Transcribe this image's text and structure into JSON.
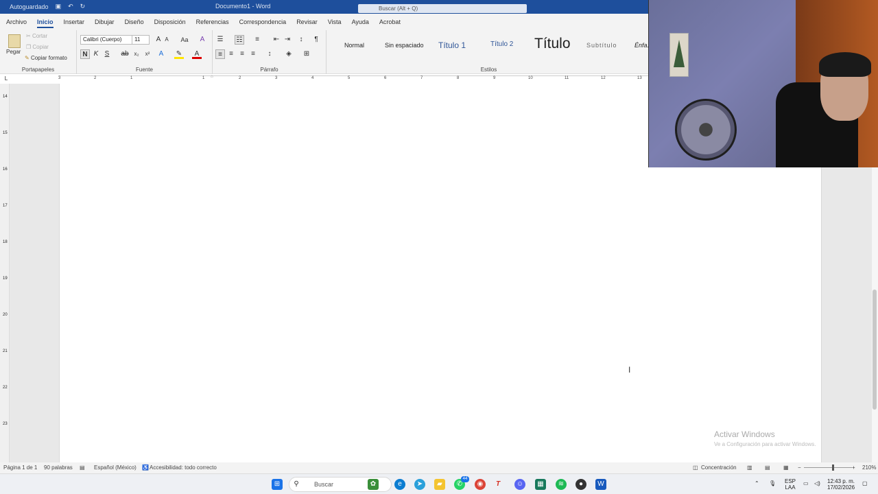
{
  "titlebar": {
    "autosave": "Autoguardado",
    "document": "Documento1 - Word",
    "search_placeholder": "Buscar (Alt + Q)"
  },
  "tabs": [
    "Archivo",
    "Inicio",
    "Insertar",
    "Dibujar",
    "Diseño",
    "Disposición",
    "Referencias",
    "Correspondencia",
    "Revisar",
    "Vista",
    "Ayuda",
    "Acrobat"
  ],
  "clipboard": {
    "paste": "Pegar",
    "cut": "Cortar",
    "copy": "Copiar",
    "format_painter": "Copiar formato",
    "label": "Portapapeles"
  },
  "font": {
    "name": "Calibri (Cuerpo)",
    "size": "11",
    "label": "Fuente",
    "bold": "N",
    "italic": "K",
    "underline": "S",
    "sub": "x₂",
    "sup": "x²"
  },
  "paragraph": {
    "label": "Párrafo"
  },
  "styles": {
    "label": "Estilos",
    "items": [
      "Normal",
      "Sin espaciado",
      "Título 1",
      "Título 2",
      "Título",
      "Subtítulo",
      "Énfa..."
    ]
  },
  "ruler": {
    "ticks": [
      "3",
      "2",
      "1",
      "1",
      "2",
      "3",
      "4",
      "5",
      "6",
      "7",
      "8",
      "9",
      "10",
      "11",
      "12",
      "13"
    ]
  },
  "vruler": {
    "ticks": [
      "14",
      "15",
      "16",
      "17",
      "18",
      "19",
      "20",
      "21",
      "22",
      "23"
    ]
  },
  "status": {
    "page": "Página 1 de 1",
    "words": "90 palabras",
    "language": "Español (México)",
    "accessibility": "Accesibilidad: todo correcto",
    "focus": "Concentración",
    "zoom": "210%"
  },
  "watermark": {
    "line1": "Activar Windows",
    "line2": "Ve a Configuración para activar Windows."
  },
  "taskbar": {
    "search": "Buscar",
    "whatsapp_badge": "44",
    "lang1": "ESP",
    "lang2": "LAA",
    "time": "12:43 p. m.",
    "date": "17/02/2026"
  },
  "colors": {
    "accent": "#1e4f9c",
    "word_blue": "#185abd"
  }
}
